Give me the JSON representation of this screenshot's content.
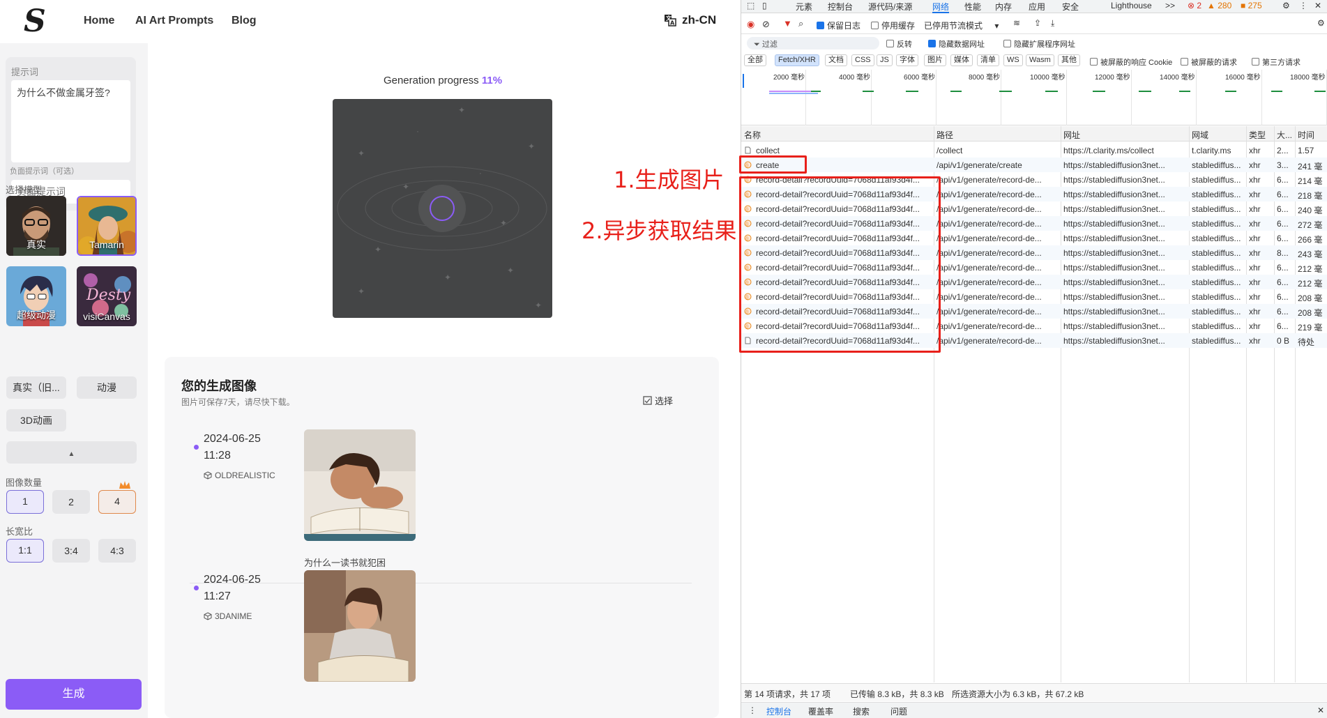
{
  "app": {
    "nav": {
      "home": "Home",
      "prompts": "AI Art Prompts",
      "blog": "Blog",
      "lang": "zh-CN"
    },
    "sidebar": {
      "prompt_label": "提示词",
      "prompt_value": "为什么不做金属牙签?",
      "neg_label": "负面提示词（可选）",
      "neg_placeholder": "负面提示词",
      "model_label": "选择模型",
      "models": [
        "真实",
        "Tamarin",
        "超级动漫",
        "visiCanvas"
      ],
      "chips": [
        "真实（旧...",
        "动漫",
        "3D动画"
      ],
      "count_label": "图像数量",
      "counts": [
        "1",
        "2",
        "4"
      ],
      "ratio_label": "长宽比",
      "ratios": [
        "1:1",
        "3:4",
        "4:3"
      ],
      "generate": "生成"
    },
    "progress": {
      "label": "Generation progress",
      "value": "11%",
      "fraction": 0.11
    },
    "images": {
      "title": "您的生成图像",
      "subtitle": "图片可保存7天，请尽快下载。",
      "select": "选择",
      "entries": [
        {
          "date": "2024-06-25",
          "time": "11:28",
          "model": "OLDREALISTIC",
          "caption": "为什么一读书就犯困"
        },
        {
          "date": "2024-06-25",
          "time": "11:27",
          "model": "3DANIME",
          "caption": ""
        }
      ]
    },
    "annotations": {
      "step1": "1.生成图片",
      "step2": "2.异步获取结果"
    },
    "accent": "#8b5cf6"
  },
  "devtools": {
    "tabs": [
      "元素",
      "控制台",
      "源代码/来源",
      "网络",
      "性能",
      "内存",
      "应用",
      "安全",
      "Lighthouse"
    ],
    "more": ">>",
    "counts": {
      "errors": "2",
      "warnings": "280",
      "issues": "275"
    },
    "toolbar": {
      "preserve_log": "保留日志",
      "disable_cache": "停用缓存",
      "throttle": "已停用节流模式"
    },
    "filter": {
      "placeholder": "过滤",
      "invert": "反转",
      "hide_data": "隐藏数据网址",
      "hide_ext": "隐藏扩展程序网址"
    },
    "types": [
      "全部",
      "Fetch/XHR",
      "文档",
      "CSS",
      "JS",
      "字体",
      "图片",
      "媒体",
      "清单",
      "WS",
      "Wasm",
      "其他"
    ],
    "type_options": [
      "被屏蔽的响应 Cookie",
      "被屏蔽的请求",
      "第三方请求"
    ],
    "ticks": [
      "2000 毫秒",
      "4000 毫秒",
      "6000 毫秒",
      "8000 毫秒",
      "10000 毫秒",
      "12000 毫秒",
      "14000 毫秒",
      "16000 毫秒",
      "18000 毫秒"
    ],
    "columns": [
      "名称",
      "路径",
      "网址",
      "网域",
      "类型",
      "大...",
      "时间"
    ],
    "rows": [
      {
        "name": "collect",
        "path": "/collect",
        "url": "https://t.clarity.ms/collect",
        "domain": "t.clarity.ms",
        "type": "xhr",
        "size": "2...",
        "time": "1.57"
      },
      {
        "name": "create",
        "path": "/api/v1/generate/create",
        "url": "https://stablediffusion3net...",
        "domain": "stablediffus...",
        "type": "xhr",
        "size": "3...",
        "time": "241 毫"
      },
      {
        "name": "record-detail?recordUuid=7068d11af93d4f...",
        "path": "/api/v1/generate/record-de...",
        "url": "https://stablediffusion3net...",
        "domain": "stablediffus...",
        "type": "xhr",
        "size": "6...",
        "time": "214 毫"
      },
      {
        "name": "record-detail?recordUuid=7068d11af93d4f...",
        "path": "/api/v1/generate/record-de...",
        "url": "https://stablediffusion3net...",
        "domain": "stablediffus...",
        "type": "xhr",
        "size": "6...",
        "time": "218 毫"
      },
      {
        "name": "record-detail?recordUuid=7068d11af93d4f...",
        "path": "/api/v1/generate/record-de...",
        "url": "https://stablediffusion3net...",
        "domain": "stablediffus...",
        "type": "xhr",
        "size": "6...",
        "time": "240 毫"
      },
      {
        "name": "record-detail?recordUuid=7068d11af93d4f...",
        "path": "/api/v1/generate/record-de...",
        "url": "https://stablediffusion3net...",
        "domain": "stablediffus...",
        "type": "xhr",
        "size": "6...",
        "time": "272 毫"
      },
      {
        "name": "record-detail?recordUuid=7068d11af93d4f...",
        "path": "/api/v1/generate/record-de...",
        "url": "https://stablediffusion3net...",
        "domain": "stablediffus...",
        "type": "xhr",
        "size": "6...",
        "time": "266 毫"
      },
      {
        "name": "record-detail?recordUuid=7068d11af93d4f...",
        "path": "/api/v1/generate/record-de...",
        "url": "https://stablediffusion3net...",
        "domain": "stablediffus...",
        "type": "xhr",
        "size": "8...",
        "time": "243 毫"
      },
      {
        "name": "record-detail?recordUuid=7068d11af93d4f...",
        "path": "/api/v1/generate/record-de...",
        "url": "https://stablediffusion3net...",
        "domain": "stablediffus...",
        "type": "xhr",
        "size": "6...",
        "time": "212 毫"
      },
      {
        "name": "record-detail?recordUuid=7068d11af93d4f...",
        "path": "/api/v1/generate/record-de...",
        "url": "https://stablediffusion3net...",
        "domain": "stablediffus...",
        "type": "xhr",
        "size": "6...",
        "time": "212 毫"
      },
      {
        "name": "record-detail?recordUuid=7068d11af93d4f...",
        "path": "/api/v1/generate/record-de...",
        "url": "https://stablediffusion3net...",
        "domain": "stablediffus...",
        "type": "xhr",
        "size": "6...",
        "time": "208 毫"
      },
      {
        "name": "record-detail?recordUuid=7068d11af93d4f...",
        "path": "/api/v1/generate/record-de...",
        "url": "https://stablediffusion3net...",
        "domain": "stablediffus...",
        "type": "xhr",
        "size": "6...",
        "time": "208 毫"
      },
      {
        "name": "record-detail?recordUuid=7068d11af93d4f...",
        "path": "/api/v1/generate/record-de...",
        "url": "https://stablediffusion3net...",
        "domain": "stablediffus...",
        "type": "xhr",
        "size": "6...",
        "time": "219 毫"
      },
      {
        "name": "record-detail?recordUuid=7068d11af93d4f...",
        "path": "/api/v1/generate/record-de...",
        "url": "https://stablediffusion3net...",
        "domain": "stablediffus...",
        "type": "xhr",
        "size": "0 B",
        "time": "待处"
      }
    ],
    "status": {
      "requests": "第 14 项请求，共 17 项",
      "transferred": "已传输 8.3 kB，共 8.3 kB",
      "resources": "所选资源大小为 6.3 kB，共 67.2 kB"
    },
    "drawer": [
      "控制台",
      "覆盖率",
      "搜索",
      "问题"
    ]
  }
}
